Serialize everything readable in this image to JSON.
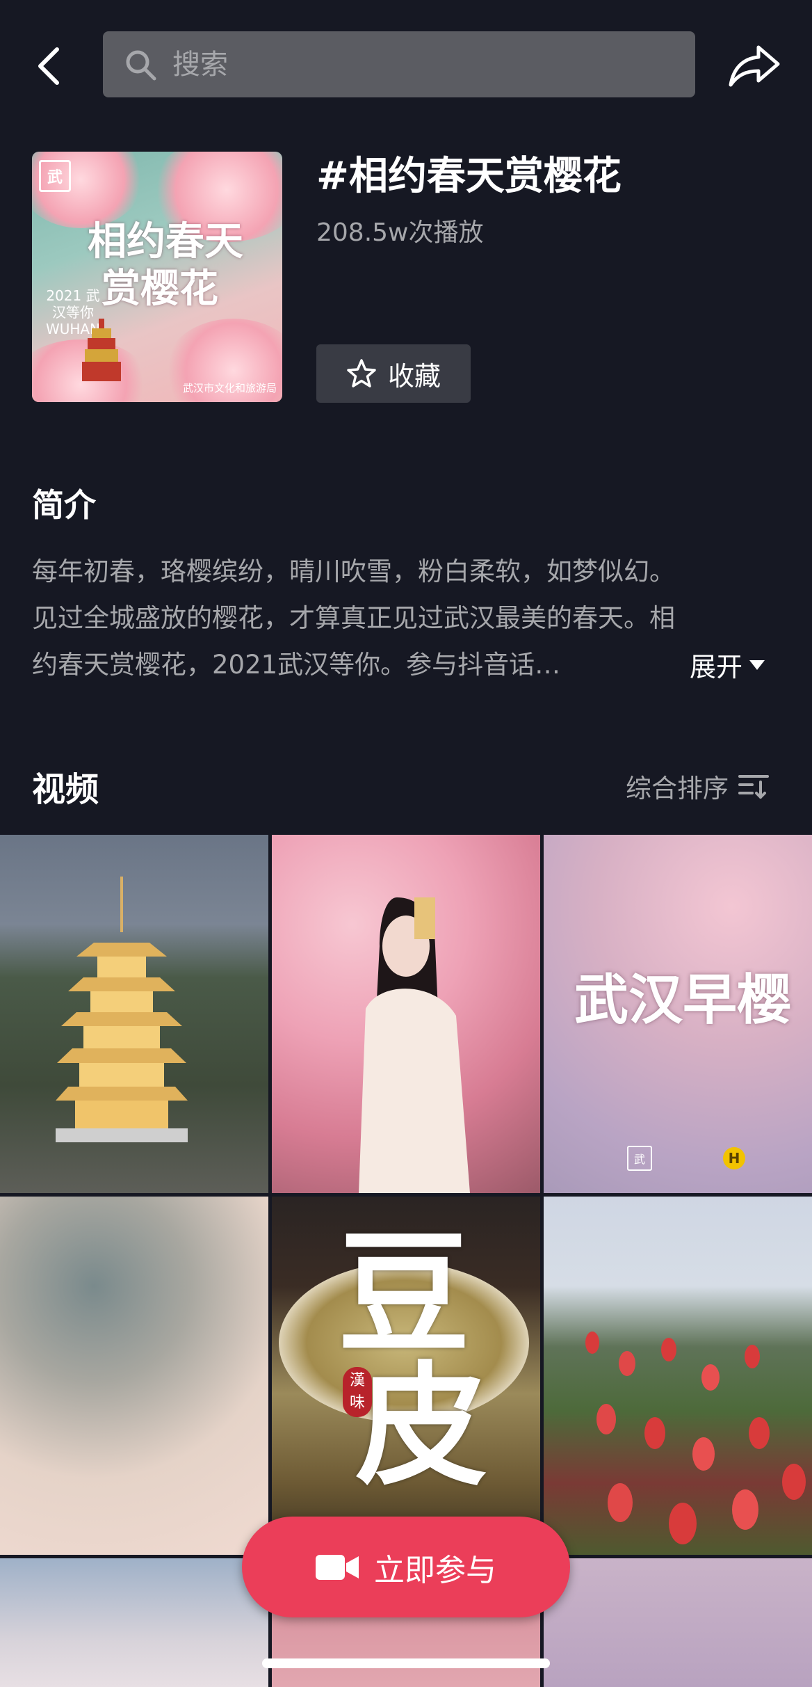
{
  "header": {
    "search_placeholder": "搜索"
  },
  "topic": {
    "title": "#相约春天赏樱花",
    "play_count": "208.5w次播放",
    "favorite_label": "收藏",
    "cover": {
      "title_line1": "相约春天",
      "title_line2": "赏樱花",
      "year_text": "2021 武汉等你 WUHAN",
      "logo_text": "武",
      "org_text": "武汉市文化和旅游局"
    }
  },
  "intro": {
    "heading": "简介",
    "lines": [
      "每年初春，珞樱缤纷，晴川吹雪，粉白柔软，如梦似幻。",
      "见过全城盛放的樱花，才算真正见过武汉最美的春天。相",
      "约春天赏樱花，2021武汉等你。参与抖音话…"
    ],
    "expand_label": "展开"
  },
  "videos": {
    "heading": "视频",
    "sort_label": "综合排序",
    "tiles": [
      {
        "id": "pagoda-video"
      },
      {
        "id": "hanfu-girl-video"
      },
      {
        "id": "wuhan-early-cherry-video",
        "overlay_text": "武汉早樱"
      },
      {
        "id": "cherry-sky-video"
      },
      {
        "id": "doupi-food-video",
        "char1": "豆",
        "char2": "皮",
        "seal_text": "漢味"
      },
      {
        "id": "tulip-field-video"
      },
      {
        "id": "cherry-building-video"
      },
      {
        "id": "pink-video"
      },
      {
        "id": "purple-video"
      }
    ]
  },
  "join_button": {
    "label": "立即参与"
  },
  "colors": {
    "background": "#161823",
    "search_bg": "#5b5c62",
    "muted_text": "#a6a7ab",
    "button_bg": "#393b44",
    "accent": "#eb3e59"
  }
}
